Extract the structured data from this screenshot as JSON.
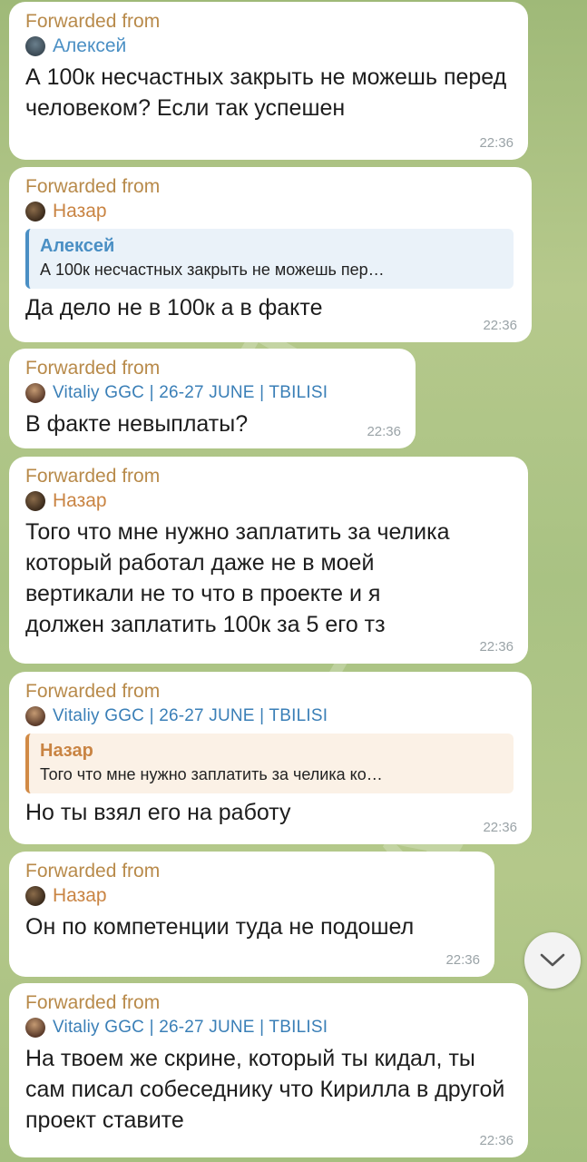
{
  "watermark": "ЯАЗЛОТА",
  "messages": [
    {
      "forwarded": "Forwarded from",
      "sender": "Алексей",
      "text": "А 100к несчастных закрыть не можешь перед человеком? Если так успешен",
      "time": "22:36"
    },
    {
      "forwarded": "Forwarded from",
      "sender": "Назар",
      "quote_name": "Алексей",
      "quote_text": "А 100к несчастных закрыть не можешь пер…",
      "text": "Да дело не в 100к а в факте",
      "time": "22:36"
    },
    {
      "forwarded": "Forwarded from",
      "sender": "Vitaliy GGC | 26-27 JUNE | TBILISI",
      "text": "В факте невыплаты?",
      "time": "22:36"
    },
    {
      "forwarded": "Forwarded from",
      "sender": "Назар",
      "text": "Того что мне нужно заплатить за челика который работал даже не в моей вертикали не то что в проекте и я должен заплатить 100к за 5 его тз",
      "time": "22:36"
    },
    {
      "forwarded": "Forwarded from",
      "sender": "Vitaliy GGC | 26-27 JUNE | TBILISI",
      "quote_name": "Назар",
      "quote_text": "Того что мне нужно заплатить за челика ко…",
      "text": "Но ты взял его на работу",
      "time": "22:36"
    },
    {
      "forwarded": "Forwarded from",
      "sender": "Назар",
      "text": "Он по компетенции туда не подошел",
      "time": "22:36"
    },
    {
      "forwarded": "Forwarded from",
      "sender": "Vitaliy GGC | 26-27 JUNE | TBILISI",
      "text": "На твоем же скрине, который ты кидал, ты сам писал собеседнику что Кирилла в другой проект ставите",
      "time": "22:36"
    }
  ],
  "icons": {
    "scroll_down": "chevron-down-icon"
  }
}
